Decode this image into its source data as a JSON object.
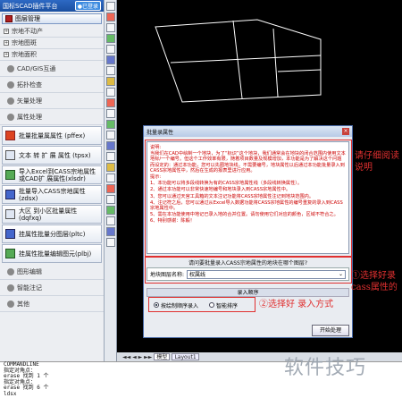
{
  "left_panel": {
    "title": "国标SCAD插件平台",
    "badge": "●已登录",
    "manager_label": "图层管理",
    "sections": [
      {
        "label": "宗地不动产"
      },
      {
        "label": "宗地图斑"
      },
      {
        "label": "宗地面积"
      }
    ],
    "cadgis_label": "CAD/GIS互通",
    "check_label": "拓扑检查",
    "vector_label": "矢量处理",
    "attr_label": "属性处理",
    "buttons": [
      "批量批量属属性 (pffex)",
      "文本 转 扩 展 属性 (tpsx)",
      "导入Excel到CASS宗地属性或CAD扩 展属性(xlsdr)",
      "批量导入CASS宗地属性 (zdsx)",
      "大区 到小区批量属性 (dqfxq)",
      "挂属性批量分图层(pltc)",
      "挂属性批量编辑图元(plbj)"
    ],
    "tail_sections": [
      "图形编辑",
      "智能注记",
      "其他"
    ]
  },
  "cad": {
    "tabs": [
      "模型",
      "Layout1"
    ]
  },
  "command": {
    "lines": [
      "COMMANDLINE",
      "指定对角点：",
      "   erase 找到 1 个",
      "指定对角点：",
      "   erase 找到 6 个",
      "ldsx"
    ]
  },
  "dialog": {
    "title": "批量录属性",
    "desc_head": "说明:",
    "desc_para": "当我们在CAD中绘制一个地块，为了“标识”这个地块，我们通常会在地块的闭合范围内使用文本地标/一个编号。但这个工作效率有限，随着项目数量及规模增加，本功能是为了解决这个问题而设定的：通过本功能，您可以先圈地块线，不需要编号，地块属性以后通过本功能批量录入到CASS宗地属性中，然后在生成的报表里进行应用。",
    "tips_head": "提示:",
    "tips": [
      "1、本功能可以将多段线转换为有的CASS宗地属性线（多段线转换属性）。",
      "2、通过本功能可以非常快速地编号和地块录入到CASS宗地属性中。",
      "3、您可以通过天宫工具箱的文本注记功能将CASS宗地属性注记到地块范围内。",
      "4、注记符之后，您可以通过从Excel导入数据功能将CASS宗地属性的编号重复的录入到CASS宗地属性中。",
      "5、需在本功能使用中地记已录入地的合并位置。请勿使用它们对应的颜色，区域不符合之。",
      "6、特别感谢：陈毅！"
    ],
    "select_prompt": "请问要批量录入CASS宗地属性的地块在哪个图层?",
    "layer_label": "地块图层名称:",
    "layer_value": "权属线",
    "order_head": "录入顺序",
    "order_options": [
      {
        "label": "按绘制顺序录入",
        "checked": true
      },
      {
        "label": "智能排序",
        "checked": false
      }
    ],
    "start_label": "开始处理"
  },
  "annotations": {
    "a1": "请仔细阅读",
    "a1b": "说明",
    "a2": "①选择好录",
    "a2b": "cass属性的",
    "a3": "②选择好   录入方式"
  },
  "watermark": "软件技巧"
}
